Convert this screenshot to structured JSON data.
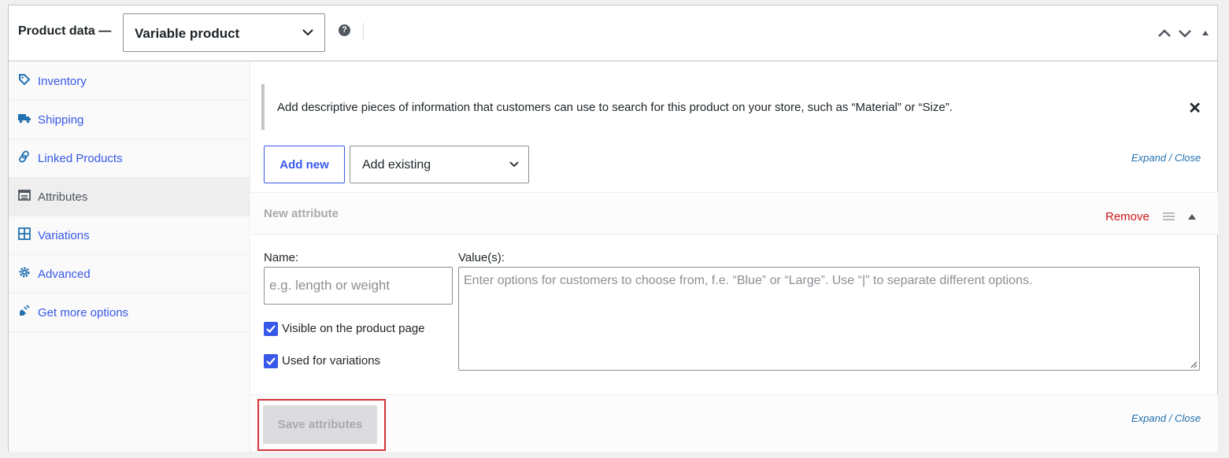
{
  "header": {
    "title": "Product data —",
    "product_type": "Variable product",
    "help_icon": "help-icon",
    "controls": [
      "chevron-up-icon",
      "chevron-down-icon",
      "collapse-triangle-icon"
    ]
  },
  "sidebar": {
    "items": [
      {
        "label": "Inventory",
        "icon": "tag-icon"
      },
      {
        "label": "Shipping",
        "icon": "truck-icon"
      },
      {
        "label": "Linked Products",
        "icon": "link-icon"
      },
      {
        "label": "Attributes",
        "icon": "attributes-list-icon",
        "active": true
      },
      {
        "label": "Variations",
        "icon": "grid-icon"
      },
      {
        "label": "Advanced",
        "icon": "gear-icon"
      },
      {
        "label": "Get more options",
        "icon": "plugin-icon"
      }
    ]
  },
  "notice": {
    "text": "Add descriptive pieces of information that customers can use to search for this product on your store, such as “Material” or “Size”.",
    "close": "✕"
  },
  "toolbar": {
    "add_new": "Add new",
    "add_existing": "Add existing",
    "expand": "Expand",
    "sep": "/",
    "close": "Close"
  },
  "attribute": {
    "title": "New attribute",
    "remove": "Remove",
    "name_label": "Name:",
    "name_placeholder": "e.g. length or weight",
    "values_label": "Value(s):",
    "values_placeholder": "Enter options for customers to choose from, f.e. “Blue” or “Large”. Use “|” to separate different options.",
    "visible_label": "Visible on the product page",
    "visible_checked": true,
    "variations_label": "Used for variations",
    "variations_checked": true
  },
  "footer": {
    "save": "Save attributes",
    "expand": "Expand",
    "sep": "/",
    "close": "Close"
  },
  "colors": {
    "accent": "#3858e9",
    "link": "#2271b1",
    "danger": "#cc1818",
    "highlight": "#d63638"
  }
}
